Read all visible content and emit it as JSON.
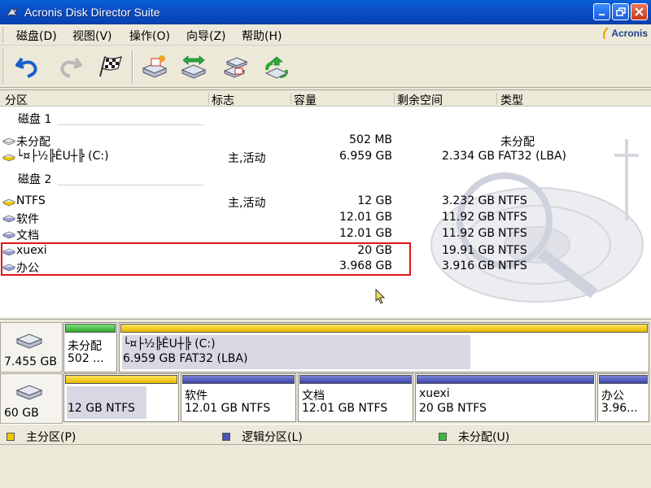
{
  "window": {
    "title": "Acronis Disk Director Suite"
  },
  "menu": [
    "磁盘(D)",
    "视图(V)",
    "操作(O)",
    "向导(Z)",
    "帮助(H)"
  ],
  "brand": "Acronis",
  "columns": {
    "partition": "分区",
    "flag": "标志",
    "capacity": "容量",
    "free": "剩余空间",
    "type": "类型"
  },
  "groups": [
    "磁盘 1",
    "磁盘 2"
  ],
  "rows": [
    {
      "name": "未分配",
      "flag": "",
      "capacity": "502 MB",
      "free": "",
      "type": "未分配"
    },
    {
      "name": "└¤├½╠ÊU┼╠ (C:)",
      "flag": "主,活动",
      "capacity": "6.959 GB",
      "free": "2.334 GB",
      "type": "FAT32 (LBA)"
    },
    {
      "name": "NTFS",
      "flag": "主,活动",
      "capacity": "12 GB",
      "free": "3.232 GB",
      "type": "NTFS"
    },
    {
      "name": "软件",
      "flag": "",
      "capacity": "12.01 GB",
      "free": "11.92 GB",
      "type": "NTFS"
    },
    {
      "name": "文档",
      "flag": "",
      "capacity": "12.01 GB",
      "free": "11.92 GB",
      "type": "NTFS"
    },
    {
      "name": "xuexi",
      "flag": "",
      "capacity": "20 GB",
      "free": "19.91 GB",
      "type": "NTFS"
    },
    {
      "name": "办公",
      "flag": "",
      "capacity": "3.968 GB",
      "free": "3.916 GB",
      "type": "NTFS"
    }
  ],
  "disks": [
    {
      "size": "7.455 GB",
      "parts": [
        {
          "line1": "未分配",
          "line2": "502 ..."
        },
        {
          "line1": "└¤├½╠ÊU┼╠ (C:)",
          "line2": "6.959 GB  FAT32 (LBA)"
        }
      ]
    },
    {
      "size": "60 GB",
      "parts": [
        {
          "line1": "",
          "line2": "12 GB  NTFS"
        },
        {
          "line1": "软件",
          "line2": "12.01 GB  NTFS"
        },
        {
          "line1": "文档",
          "line2": "12.01 GB  NTFS"
        },
        {
          "line1": "xuexi",
          "line2": "20 GB  NTFS"
        },
        {
          "line1": "办公",
          "line2": "3.96..."
        }
      ]
    }
  ],
  "legend": [
    "主分区(P)",
    "逻辑分区(L)",
    "未分配(U)"
  ],
  "colors": {
    "primary": "#f0c800",
    "logical": "#4a52b8",
    "unallocated": "#3cb83c",
    "highlight": "#e0141a"
  }
}
